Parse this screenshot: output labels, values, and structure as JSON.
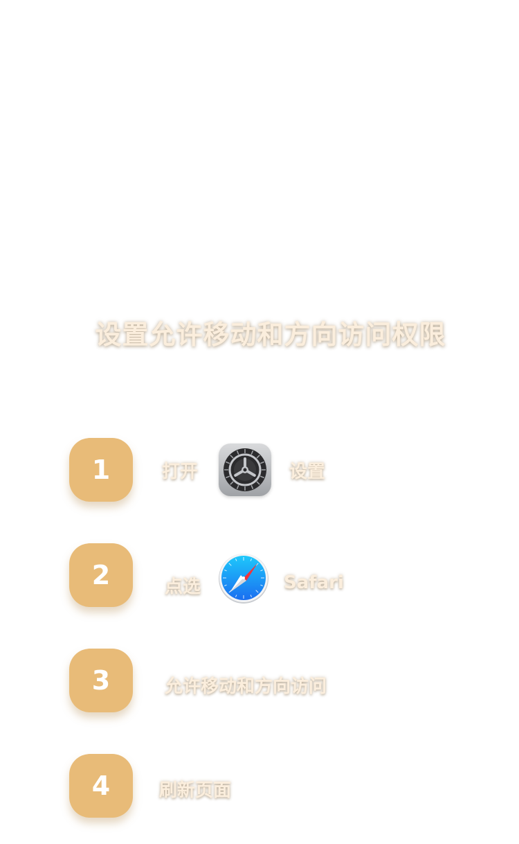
{
  "title": "设置允许移动和方向访问权限",
  "steps": [
    {
      "number": "1",
      "text_before": "打开",
      "icon": "settings-icon",
      "text_after": "设置"
    },
    {
      "number": "2",
      "text_before": "点选",
      "icon": "safari-icon",
      "text_after": "Safari"
    },
    {
      "number": "3",
      "text": "允许移动和方向访问"
    },
    {
      "number": "4",
      "text": "刷新页面"
    }
  ],
  "colors": {
    "badge": "#e8bb78",
    "label": "#fbeedd",
    "background": "#ffffff"
  }
}
